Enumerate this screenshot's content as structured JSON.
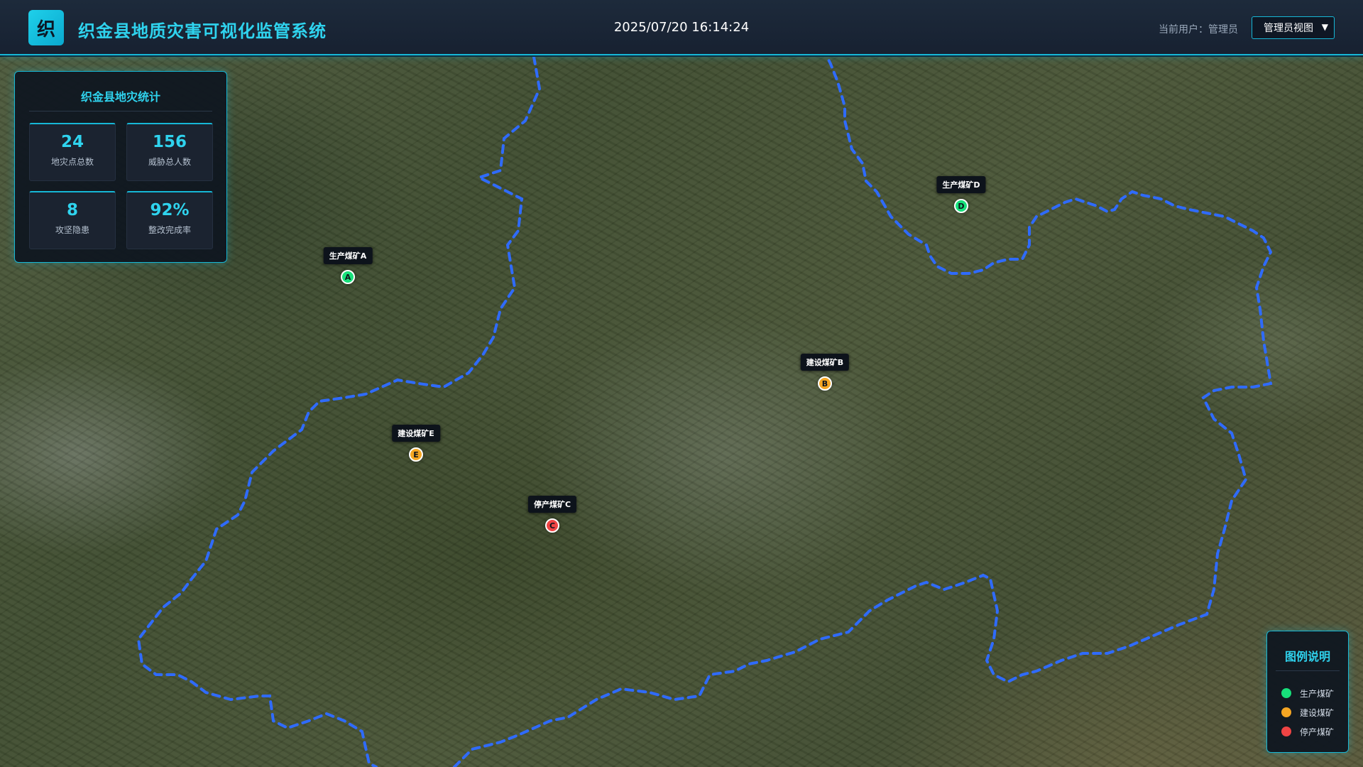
{
  "header": {
    "logo_char": "织",
    "title": "织金县地质灾害可视化监管系统",
    "datetime": "2025/07/20 16:14:24",
    "user_label": "当前用户：管理员",
    "view_select": {
      "selected": "管理员视图"
    }
  },
  "stats": {
    "title": "织金县地灾统计",
    "cards": [
      {
        "value": "24",
        "label": "地灾点总数"
      },
      {
        "value": "156",
        "label": "威胁总人数"
      },
      {
        "value": "8",
        "label": "攻坚隐患"
      },
      {
        "value": "92%",
        "label": "整改完成率"
      }
    ]
  },
  "mines": [
    {
      "label": "生产煤矿A",
      "code": "A",
      "status": "production"
    },
    {
      "label": "建设煤矿B",
      "code": "B",
      "status": "construction"
    },
    {
      "label": "停产煤矿C",
      "code": "C",
      "status": "stopped"
    },
    {
      "label": "生产煤矿D",
      "code": "D",
      "status": "production"
    },
    {
      "label": "建设煤矿E",
      "code": "E",
      "status": "construction"
    }
  ],
  "legend": {
    "title": "图例说明",
    "items": [
      {
        "label": "生产煤矿",
        "color": "#17e07a"
      },
      {
        "label": "建设煤矿",
        "color": "#f5a623"
      },
      {
        "label": "停产煤矿",
        "color": "#ef4444"
      }
    ]
  },
  "colors": {
    "accent": "#16b7d6",
    "boundary": "#2f6bff",
    "production": "#17e07a",
    "construction": "#f5a623",
    "stopped": "#ef4444"
  }
}
